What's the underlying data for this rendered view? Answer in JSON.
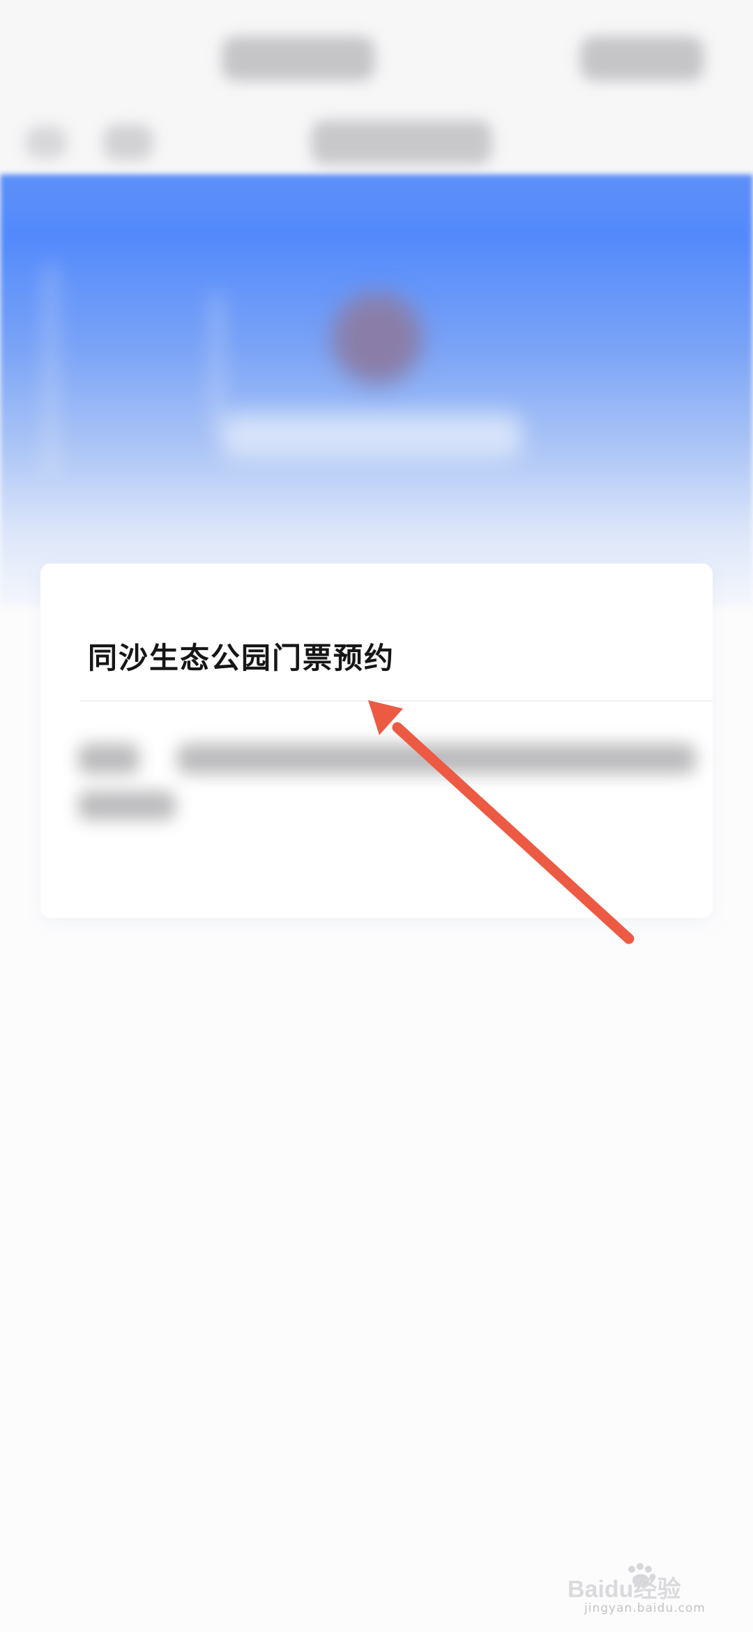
{
  "card": {
    "title": "同沙生态公园门票预约"
  },
  "watermark": {
    "logo_text": "Baidu经验",
    "sub_text": "jingyan.baidu.com"
  },
  "annotation": {
    "arrow_color": "#ed5a44"
  },
  "colors": {
    "hero_blue": "#5289fb",
    "background": "#fcfcfd"
  },
  "icons": {
    "watermark_logo": "baidu-paw-icon",
    "annotation": "red-arrow-icon"
  }
}
